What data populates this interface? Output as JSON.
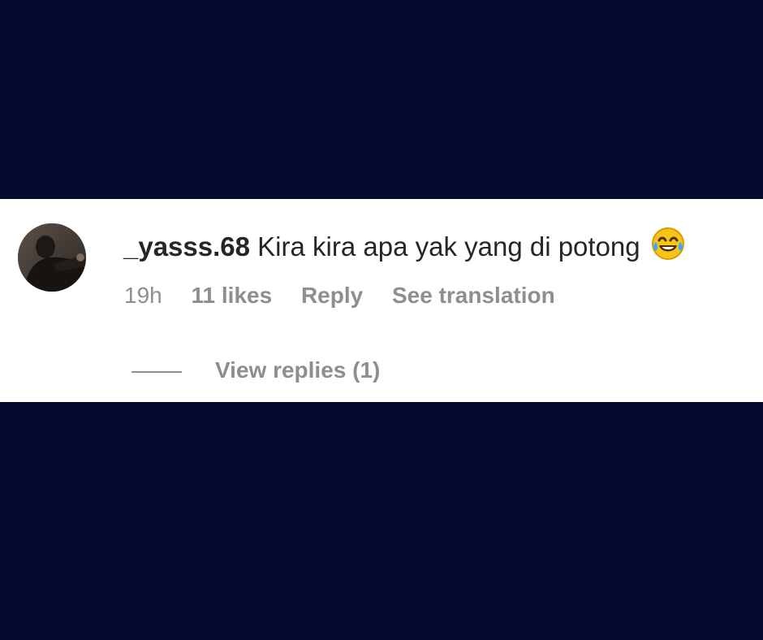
{
  "colors": {
    "page_background": "#050b2e",
    "card_background": "#ffffff",
    "text_primary": "#262626",
    "text_secondary": "#8e8e8e"
  },
  "comment": {
    "avatar_icon": "user-avatar",
    "username": "_yasss.68",
    "text": "Kira kira apa yak yang di potong",
    "emoji": "face-with-tears-of-joy-icon",
    "time": "19h",
    "likes": "11 likes",
    "reply_label": "Reply",
    "translation_label": "See translation",
    "view_replies_label": "View replies (1)"
  }
}
